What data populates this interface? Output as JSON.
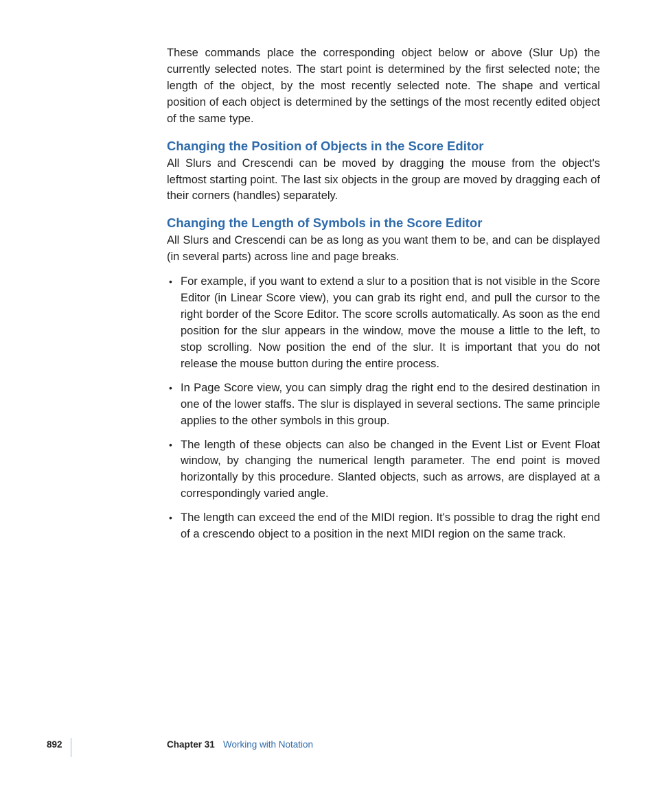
{
  "intro_paragraph": "These commands place the corresponding object below or above (Slur Up) the currently selected notes. The start point is determined by the first selected note; the length of the object, by the most recently selected note. The shape and vertical position of each object is determined by the settings of the most recently edited object of the same type.",
  "section1": {
    "heading": "Changing the Position of Objects in the Score Editor",
    "paragraph": "All Slurs and Crescendi can be moved by dragging the mouse from the object's leftmost starting point. The last six objects in the group are moved by dragging each of their corners (handles) separately."
  },
  "section2": {
    "heading": "Changing the Length of Symbols in the Score Editor",
    "paragraph": "All Slurs and Crescendi can be as long as you want them to be, and can be displayed (in several parts) across line and page breaks.",
    "bullets": [
      "For example, if you want to extend a slur to a position that is not visible in the Score Editor (in Linear Score view), you can grab its right end, and pull the cursor to the right border of the Score Editor. The score scrolls automatically. As soon as the end position for the slur appears in the window, move the mouse a little to the left, to stop scrolling. Now position the end of the slur. It is important that you do not release the mouse button during the entire process.",
      "In Page Score view, you can simply drag the right end to the desired destination in one of the lower staffs. The slur is displayed in several sections. The same principle applies to the other symbols in this group.",
      "The length of these objects can also be changed in the Event List or Event Float window, by changing the numerical length parameter. The end point is moved horizontally by this procedure. Slanted objects, such as arrows, are displayed at a correspondingly varied angle.",
      "The length can exceed the end of the MIDI region. It's possible to drag the right end of a crescendo object to a position in the next MIDI region on the same track."
    ]
  },
  "footer": {
    "page_number": "892",
    "chapter_label": "Chapter 31",
    "chapter_title": "Working with Notation"
  }
}
